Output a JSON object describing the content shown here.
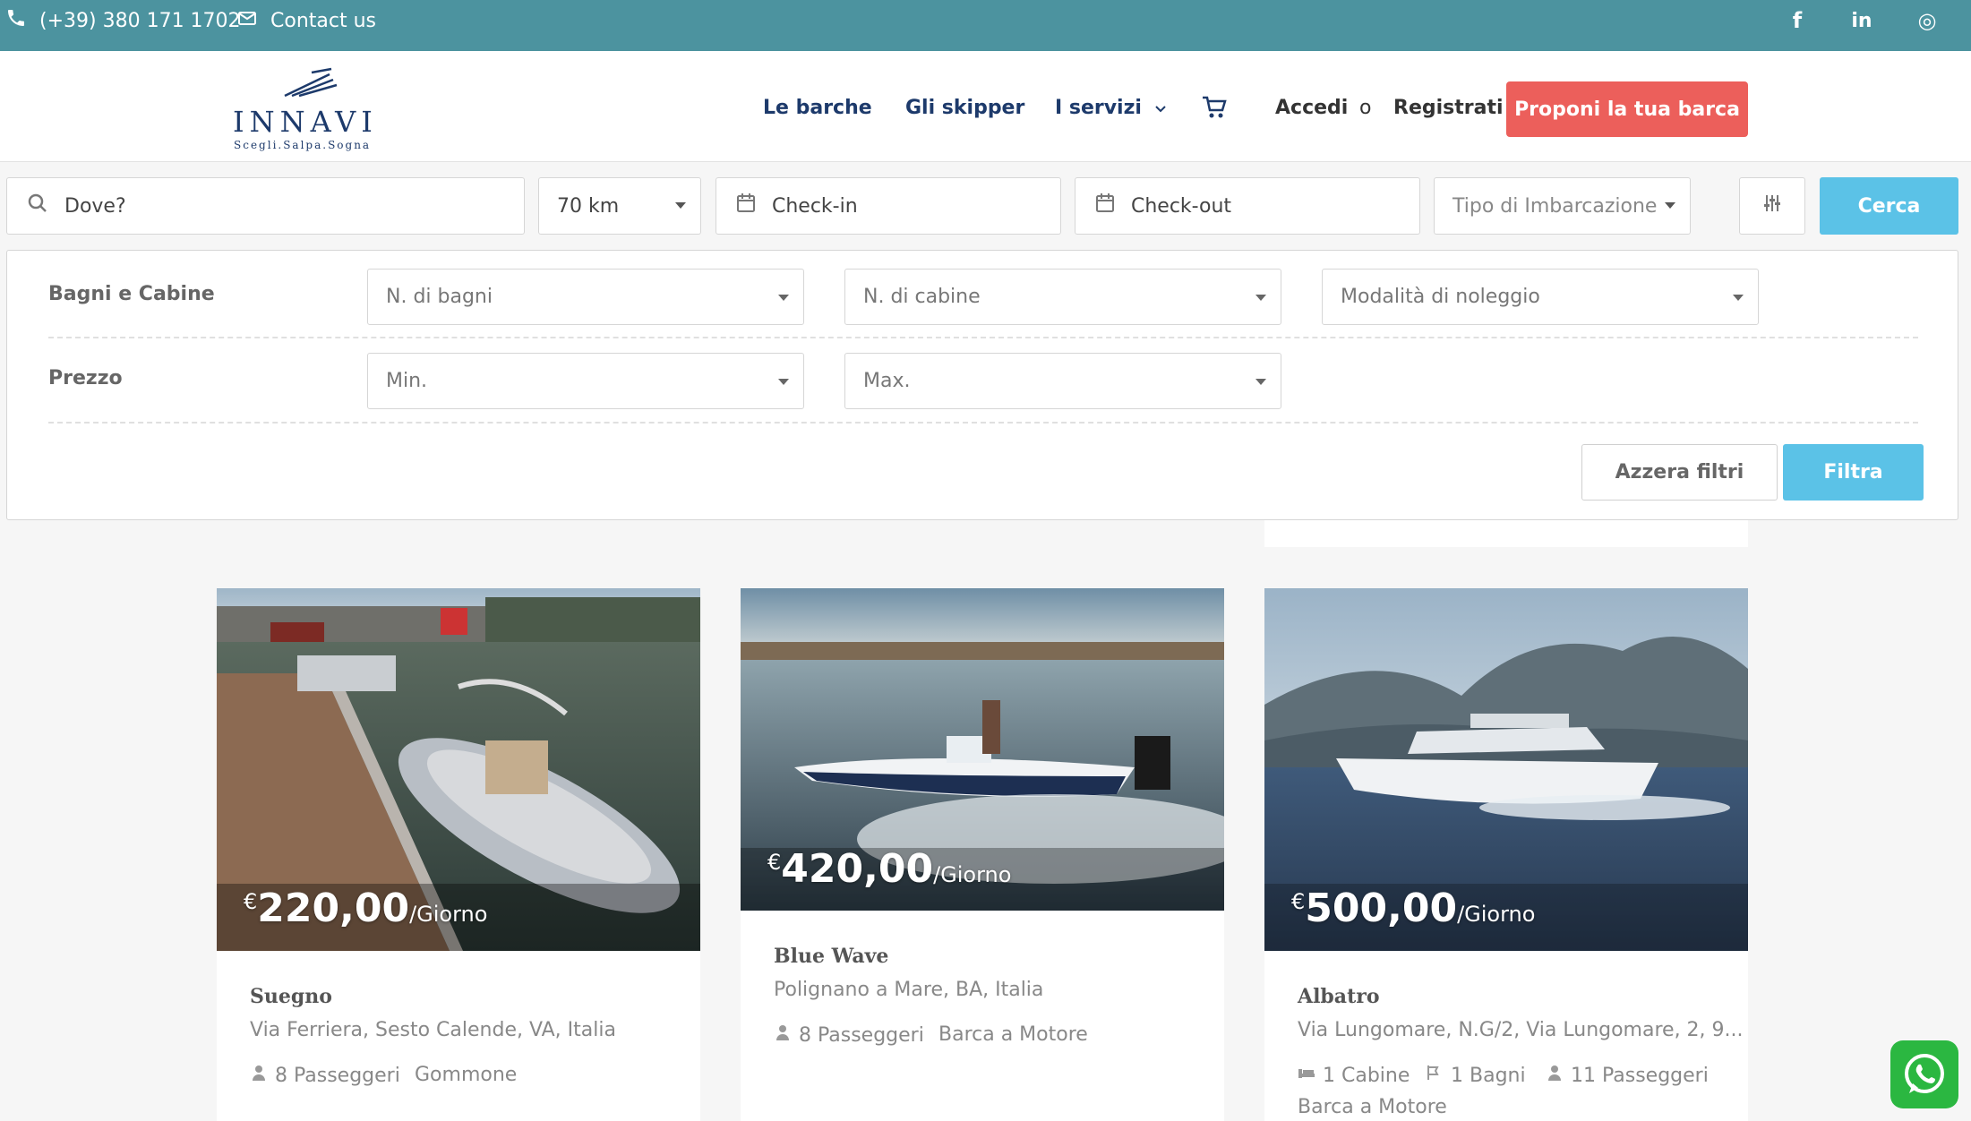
{
  "topbar": {
    "phone": "(+39) 380 171 1702",
    "contact": "Contact us",
    "social": {
      "facebook": "f",
      "linkedin": "in",
      "instagram": "◎"
    }
  },
  "brand": {
    "name": "INNAVI",
    "tagline": "Scegli.Salpa.Sogna"
  },
  "nav": {
    "boats": "Le barche",
    "skippers": "Gli skipper",
    "services": "I servizi",
    "login": "Accedi",
    "separator": "o",
    "register": "Registrati",
    "cta": "Proponi la tua barca"
  },
  "search": {
    "where_placeholder": "Dove?",
    "radius": "70 km",
    "checkin": "Check-in",
    "checkout": "Check-out",
    "boat_type": "Tipo di Imbarcazione",
    "submit": "Cerca"
  },
  "filters": {
    "baths_cabins_label": "Bagni e Cabine",
    "baths": "N. di bagni",
    "cabins": "N. di cabine",
    "rental_mode": "Modalità di noleggio",
    "price_label": "Prezzo",
    "min": "Min.",
    "max": "Max.",
    "reset": "Azzera filtri",
    "apply": "Filtra"
  },
  "listings": [
    {
      "currency": "€",
      "amount": "220,00",
      "per": "/Giorno",
      "name": "Suegno",
      "address": "Via Ferriera, Sesto Calende, VA, Italia",
      "passengers": "8 Passeggeri",
      "type": "Gommone"
    },
    {
      "currency": "€",
      "amount": "420,00",
      "per": "/Giorno",
      "name": "Blue Wave",
      "address": "Polignano a Mare, BA, Italia",
      "passengers": "8 Passeggeri",
      "type": "Barca a Motore"
    },
    {
      "currency": "€",
      "amount": "500,00",
      "per": "/Giorno",
      "name": "Albatro",
      "address": "Via Lungomare, N.G/2, Via Lungomare, 2, 9...",
      "cabins": "1 Cabine",
      "baths": "1 Bagni",
      "passengers": "11 Passeggeri",
      "type": "Barca a Motore"
    }
  ],
  "colors": {
    "topbar": "#4c939f",
    "nav_text": "#1d3a6b",
    "cta": "#ec5f5b",
    "primary_button": "#5bc2e7",
    "whatsapp": "#2bb741"
  },
  "icons": [
    "phone-icon",
    "mail-icon",
    "facebook-icon",
    "linkedin-icon",
    "instagram-icon",
    "cart-icon",
    "search-icon",
    "calendar-icon",
    "sliders-icon",
    "user-icon",
    "bed-icon",
    "bath-icon",
    "whatsapp-icon"
  ]
}
